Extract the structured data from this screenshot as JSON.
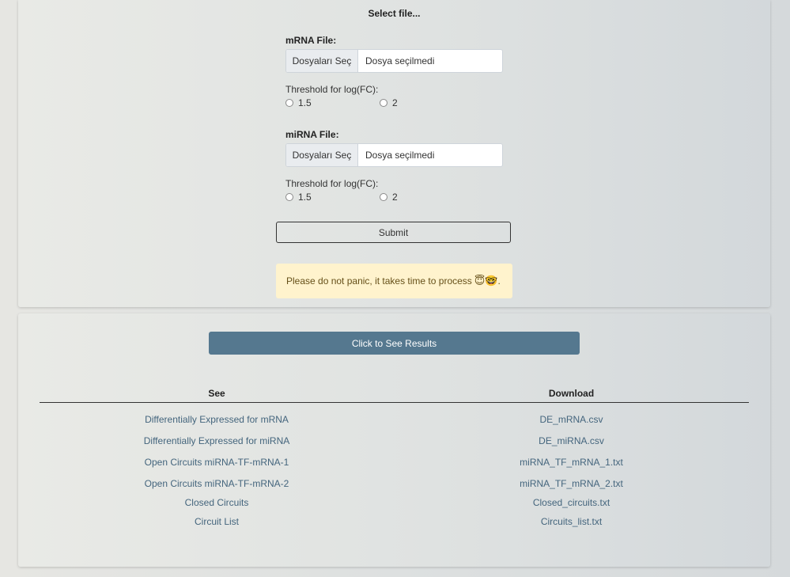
{
  "upload": {
    "title": "Select file...",
    "mrna": {
      "label": "mRNA File:",
      "button": "Dosyaları Seç",
      "filename": "Dosya seçilmedi",
      "threshold_label": "Threshold for log(FC):",
      "options": [
        "1.5",
        "2"
      ]
    },
    "mirna": {
      "label": "miRNA File:",
      "button": "Dosyaları Seç",
      "filename": "Dosya seçilmedi",
      "threshold_label": "Threshold for log(FC):",
      "options": [
        "1.5",
        "2"
      ]
    },
    "submit_label": "Submit",
    "alert_text": "Please do not panic, it takes time to process ",
    "alert_emoji": "😇🤓",
    "alert_end": "."
  },
  "results": {
    "button_label": "Click to See Results",
    "headers": {
      "see": "See",
      "download": "Download"
    },
    "rows": [
      {
        "see": "Differentially Expressed for mRNA",
        "download": "DE_mRNA.csv"
      },
      {
        "see": "Differentially Expressed for miRNA",
        "download": "DE_miRNA.csv"
      },
      {
        "see": "Open Circuits miRNA-TF-mRNA-1",
        "download": "miRNA_TF_mRNA_1.txt"
      },
      {
        "see": "Open Circuits miRNA-TF-mRNA-2",
        "download": "miRNA_TF_mRNA_2.txt"
      },
      {
        "see": "Closed Circuits",
        "download": "Closed_circuits.txt"
      },
      {
        "see": "Circuit List",
        "download": "Circuits_list.txt"
      }
    ]
  },
  "colors": {
    "results_button": "#55788f",
    "link": "#44657d",
    "alert_bg": "#fff3cd",
    "alert_text": "#665019"
  }
}
